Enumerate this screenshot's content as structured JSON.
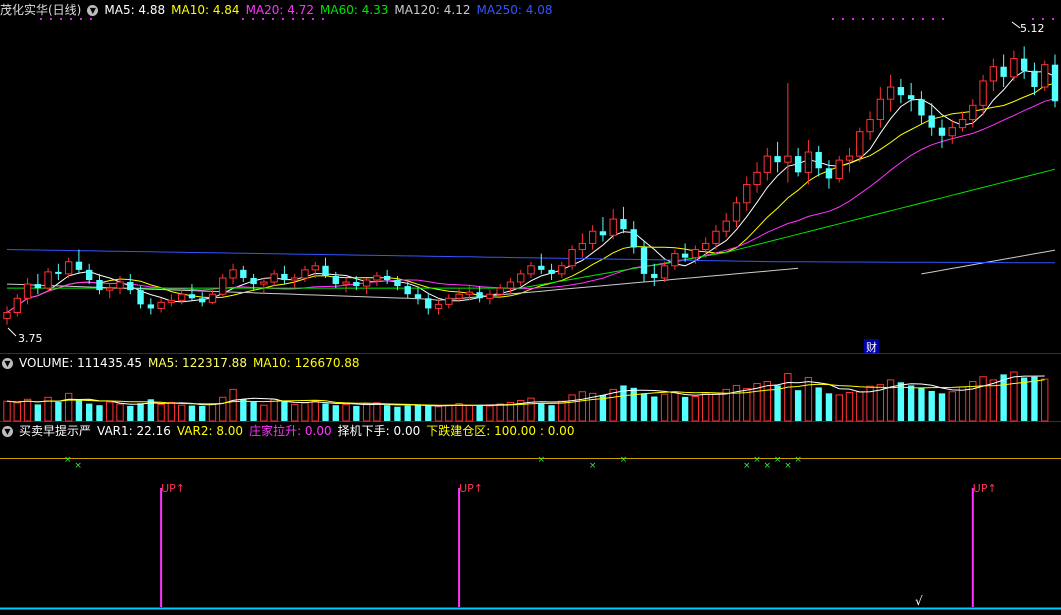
{
  "price_header": {
    "stock": "茂化实华(日线)",
    "ma": [
      {
        "label": "MA5: 4.88",
        "color": "#ffffff"
      },
      {
        "label": "MA10: 4.84",
        "color": "#ffff00"
      },
      {
        "label": "MA20: 4.72",
        "color": "#ff33ff"
      },
      {
        "label": "MA60: 4.33",
        "color": "#00e600"
      },
      {
        "label": "MA120: 4.12",
        "color": "#cccccc"
      },
      {
        "label": "MA250: 4.08",
        "color": "#3355ff"
      }
    ]
  },
  "volume_header": {
    "items": [
      {
        "label": "VOLUME: 111435.45",
        "color": "#ffffff"
      },
      {
        "label": "MA5: 122317.88",
        "color": "#ffff66"
      },
      {
        "label": "MA10: 126670.88",
        "color": "#ffff00"
      }
    ]
  },
  "indicator_header": {
    "items": [
      {
        "label": "买卖早提示严",
        "color": "#ffffff"
      },
      {
        "label": "VAR1: 22.16",
        "color": "#ffffff"
      },
      {
        "label": "VAR2: 8.00",
        "color": "#ffff00"
      },
      {
        "label": "庄家拉升: 0.00",
        "color": "#ff33ff"
      },
      {
        "label": "择机下手: 0.00",
        "color": "#ffffff"
      },
      {
        "label": "下跌建仓区: 100.00 : 0.00",
        "color": "#ffff00"
      }
    ]
  },
  "annotations": {
    "high_label": "5.12",
    "low_label": "3.75",
    "cai_label": "财",
    "up_label": "UP↑",
    "check_label": "√"
  },
  "chart_data": {
    "type": "candlestick",
    "price_range": [
      3.65,
      5.25
    ],
    "candles": [
      {
        "o": 3.78,
        "h": 3.84,
        "l": 3.75,
        "c": 3.81
      },
      {
        "o": 3.81,
        "h": 3.9,
        "l": 3.79,
        "c": 3.88
      },
      {
        "o": 3.88,
        "h": 3.98,
        "l": 3.85,
        "c": 3.95
      },
      {
        "o": 3.95,
        "h": 4.0,
        "l": 3.9,
        "c": 3.93
      },
      {
        "o": 3.93,
        "h": 4.03,
        "l": 3.91,
        "c": 4.01
      },
      {
        "o": 4.01,
        "h": 4.05,
        "l": 3.97,
        "c": 4.0
      },
      {
        "o": 4.0,
        "h": 4.08,
        "l": 3.98,
        "c": 4.06
      },
      {
        "o": 4.06,
        "h": 4.12,
        "l": 4.0,
        "c": 4.02
      },
      {
        "o": 4.02,
        "h": 4.05,
        "l": 3.95,
        "c": 3.97
      },
      {
        "o": 3.97,
        "h": 4.0,
        "l": 3.9,
        "c": 3.92
      },
      {
        "o": 3.92,
        "h": 3.95,
        "l": 3.88,
        "c": 3.93
      },
      {
        "o": 3.93,
        "h": 3.99,
        "l": 3.9,
        "c": 3.96
      },
      {
        "o": 3.96,
        "h": 4.0,
        "l": 3.9,
        "c": 3.92
      },
      {
        "o": 3.92,
        "h": 3.94,
        "l": 3.83,
        "c": 3.85
      },
      {
        "o": 3.85,
        "h": 3.88,
        "l": 3.8,
        "c": 3.83
      },
      {
        "o": 3.83,
        "h": 3.88,
        "l": 3.81,
        "c": 3.86
      },
      {
        "o": 3.86,
        "h": 3.9,
        "l": 3.84,
        "c": 3.87
      },
      {
        "o": 3.87,
        "h": 3.92,
        "l": 3.85,
        "c": 3.9
      },
      {
        "o": 3.9,
        "h": 3.95,
        "l": 3.87,
        "c": 3.88
      },
      {
        "o": 3.88,
        "h": 3.91,
        "l": 3.84,
        "c": 3.86
      },
      {
        "o": 3.86,
        "h": 3.92,
        "l": 3.85,
        "c": 3.9
      },
      {
        "o": 3.9,
        "h": 4.0,
        "l": 3.89,
        "c": 3.98
      },
      {
        "o": 3.98,
        "h": 4.05,
        "l": 3.95,
        "c": 4.02
      },
      {
        "o": 4.02,
        "h": 4.04,
        "l": 3.96,
        "c": 3.98
      },
      {
        "o": 3.98,
        "h": 4.0,
        "l": 3.92,
        "c": 3.95
      },
      {
        "o": 3.95,
        "h": 3.98,
        "l": 3.9,
        "c": 3.96
      },
      {
        "o": 3.96,
        "h": 4.02,
        "l": 3.94,
        "c": 4.0
      },
      {
        "o": 4.0,
        "h": 4.04,
        "l": 3.95,
        "c": 3.97
      },
      {
        "o": 3.97,
        "h": 4.0,
        "l": 3.93,
        "c": 3.98
      },
      {
        "o": 3.98,
        "h": 4.04,
        "l": 3.96,
        "c": 4.02
      },
      {
        "o": 4.02,
        "h": 4.06,
        "l": 3.98,
        "c": 4.04
      },
      {
        "o": 4.04,
        "h": 4.08,
        "l": 3.98,
        "c": 3.99
      },
      {
        "o": 3.99,
        "h": 4.01,
        "l": 3.93,
        "c": 3.95
      },
      {
        "o": 3.95,
        "h": 3.98,
        "l": 3.91,
        "c": 3.96
      },
      {
        "o": 3.96,
        "h": 3.99,
        "l": 3.92,
        "c": 3.94
      },
      {
        "o": 3.94,
        "h": 3.98,
        "l": 3.9,
        "c": 3.97
      },
      {
        "o": 3.97,
        "h": 4.01,
        "l": 3.94,
        "c": 3.99
      },
      {
        "o": 3.99,
        "h": 4.02,
        "l": 3.95,
        "c": 3.97
      },
      {
        "o": 3.97,
        "h": 3.99,
        "l": 3.92,
        "c": 3.94
      },
      {
        "o": 3.94,
        "h": 3.96,
        "l": 3.88,
        "c": 3.9
      },
      {
        "o": 3.9,
        "h": 3.93,
        "l": 3.85,
        "c": 3.88
      },
      {
        "o": 3.88,
        "h": 3.9,
        "l": 3.8,
        "c": 3.83
      },
      {
        "o": 3.83,
        "h": 3.87,
        "l": 3.8,
        "c": 3.85
      },
      {
        "o": 3.85,
        "h": 3.9,
        "l": 3.83,
        "c": 3.88
      },
      {
        "o": 3.88,
        "h": 3.93,
        "l": 3.86,
        "c": 3.9
      },
      {
        "o": 3.9,
        "h": 3.94,
        "l": 3.87,
        "c": 3.91
      },
      {
        "o": 3.91,
        "h": 3.94,
        "l": 3.86,
        "c": 3.88
      },
      {
        "o": 3.88,
        "h": 3.92,
        "l": 3.85,
        "c": 3.9
      },
      {
        "o": 3.9,
        "h": 3.95,
        "l": 3.88,
        "c": 3.93
      },
      {
        "o": 3.93,
        "h": 3.98,
        "l": 3.9,
        "c": 3.96
      },
      {
        "o": 3.96,
        "h": 4.02,
        "l": 3.94,
        "c": 4.0
      },
      {
        "o": 4.0,
        "h": 4.06,
        "l": 3.98,
        "c": 4.04
      },
      {
        "o": 4.04,
        "h": 4.1,
        "l": 4.0,
        "c": 4.02
      },
      {
        "o": 4.02,
        "h": 4.05,
        "l": 3.97,
        "c": 4.0
      },
      {
        "o": 4.0,
        "h": 4.06,
        "l": 3.98,
        "c": 4.04
      },
      {
        "o": 4.04,
        "h": 4.14,
        "l": 4.02,
        "c": 4.12
      },
      {
        "o": 4.12,
        "h": 4.2,
        "l": 4.08,
        "c": 4.15
      },
      {
        "o": 4.15,
        "h": 4.24,
        "l": 4.12,
        "c": 4.21
      },
      {
        "o": 4.21,
        "h": 4.28,
        "l": 4.16,
        "c": 4.19
      },
      {
        "o": 4.19,
        "h": 4.32,
        "l": 4.17,
        "c": 4.27
      },
      {
        "o": 4.27,
        "h": 4.33,
        "l": 4.2,
        "c": 4.22
      },
      {
        "o": 4.22,
        "h": 4.26,
        "l": 4.1,
        "c": 4.13
      },
      {
        "o": 4.13,
        "h": 4.16,
        "l": 3.96,
        "c": 4.0
      },
      {
        "o": 4.0,
        "h": 4.05,
        "l": 3.94,
        "c": 3.98
      },
      {
        "o": 3.98,
        "h": 4.06,
        "l": 3.96,
        "c": 4.04
      },
      {
        "o": 4.04,
        "h": 4.12,
        "l": 4.02,
        "c": 4.1
      },
      {
        "o": 4.1,
        "h": 4.15,
        "l": 4.06,
        "c": 4.08
      },
      {
        "o": 4.08,
        "h": 4.14,
        "l": 4.05,
        "c": 4.12
      },
      {
        "o": 4.12,
        "h": 4.18,
        "l": 4.08,
        "c": 4.15
      },
      {
        "o": 4.15,
        "h": 4.24,
        "l": 4.12,
        "c": 4.21
      },
      {
        "o": 4.21,
        "h": 4.3,
        "l": 4.18,
        "c": 4.26
      },
      {
        "o": 4.26,
        "h": 4.38,
        "l": 4.23,
        "c": 4.35
      },
      {
        "o": 4.35,
        "h": 4.48,
        "l": 4.31,
        "c": 4.44
      },
      {
        "o": 4.44,
        "h": 4.55,
        "l": 4.4,
        "c": 4.5
      },
      {
        "o": 4.5,
        "h": 4.62,
        "l": 4.46,
        "c": 4.58
      },
      {
        "o": 4.58,
        "h": 4.65,
        "l": 4.5,
        "c": 4.55
      },
      {
        "o": 4.55,
        "h": 4.94,
        "l": 4.45,
        "c": 4.58
      },
      {
        "o": 4.58,
        "h": 4.62,
        "l": 4.48,
        "c": 4.5
      },
      {
        "o": 4.5,
        "h": 4.66,
        "l": 4.44,
        "c": 4.6
      },
      {
        "o": 4.6,
        "h": 4.63,
        "l": 4.48,
        "c": 4.52
      },
      {
        "o": 4.52,
        "h": 4.56,
        "l": 4.42,
        "c": 4.47
      },
      {
        "o": 4.47,
        "h": 4.58,
        "l": 4.45,
        "c": 4.56
      },
      {
        "o": 4.56,
        "h": 4.62,
        "l": 4.5,
        "c": 4.58
      },
      {
        "o": 4.58,
        "h": 4.72,
        "l": 4.55,
        "c": 4.7
      },
      {
        "o": 4.7,
        "h": 4.8,
        "l": 4.66,
        "c": 4.76
      },
      {
        "o": 4.76,
        "h": 4.92,
        "l": 4.72,
        "c": 4.86
      },
      {
        "o": 4.86,
        "h": 4.98,
        "l": 4.8,
        "c": 4.92
      },
      {
        "o": 4.92,
        "h": 4.96,
        "l": 4.84,
        "c": 4.88
      },
      {
        "o": 4.88,
        "h": 4.94,
        "l": 4.8,
        "c": 4.86
      },
      {
        "o": 4.86,
        "h": 4.9,
        "l": 4.74,
        "c": 4.78
      },
      {
        "o": 4.78,
        "h": 4.84,
        "l": 4.68,
        "c": 4.72
      },
      {
        "o": 4.72,
        "h": 4.76,
        "l": 4.62,
        "c": 4.68
      },
      {
        "o": 4.68,
        "h": 4.76,
        "l": 4.64,
        "c": 4.72
      },
      {
        "o": 4.72,
        "h": 4.8,
        "l": 4.7,
        "c": 4.76
      },
      {
        "o": 4.76,
        "h": 4.86,
        "l": 4.72,
        "c": 4.83
      },
      {
        "o": 4.83,
        "h": 4.98,
        "l": 4.78,
        "c": 4.95
      },
      {
        "o": 4.95,
        "h": 5.06,
        "l": 4.9,
        "c": 5.02
      },
      {
        "o": 5.02,
        "h": 5.08,
        "l": 4.92,
        "c": 4.97
      },
      {
        "o": 4.97,
        "h": 5.1,
        "l": 4.95,
        "c": 5.06
      },
      {
        "o": 5.06,
        "h": 5.12,
        "l": 4.96,
        "c": 5.0
      },
      {
        "o": 5.0,
        "h": 5.04,
        "l": 4.88,
        "c": 4.92
      },
      {
        "o": 4.92,
        "h": 5.05,
        "l": 4.9,
        "c": 5.03
      },
      {
        "o": 5.03,
        "h": 5.08,
        "l": 4.82,
        "c": 4.85
      }
    ],
    "volume": [
      50,
      46,
      55,
      42,
      60,
      48,
      70,
      52,
      44,
      40,
      48,
      43,
      38,
      45,
      55,
      42,
      47,
      40,
      39,
      38,
      44,
      60,
      80,
      55,
      48,
      40,
      55,
      50,
      42,
      46,
      51,
      44,
      40,
      42,
      38,
      44,
      46,
      40,
      36,
      39,
      42,
      38,
      36,
      40,
      44,
      39,
      41,
      38,
      43,
      47,
      52,
      58,
      44,
      40,
      50,
      66,
      74,
      70,
      66,
      80,
      90,
      84,
      70,
      62,
      68,
      74,
      61,
      62,
      71,
      68,
      80,
      90,
      82,
      95,
      100,
      90,
      120,
      78,
      110,
      85,
      70,
      66,
      72,
      74,
      88,
      92,
      104,
      98,
      90,
      84,
      76,
      70,
      74,
      86,
      100,
      112,
      104,
      118,
      124,
      110,
      112,
      106
    ],
    "lines": {
      "MA5": {
        "color": "#ffffff"
      },
      "MA10": {
        "color": "#ffff00"
      },
      "MA20": {
        "color": "#ff33ff"
      },
      "MA60": {
        "color": "#00e600"
      },
      "MA120": {
        "color": "#cccccc"
      },
      "MA250": {
        "color": "#3355ff"
      }
    },
    "up_signal_indices": [
      15,
      44,
      94
    ],
    "x_marker_indices": [
      3,
      4,
      52,
      57,
      60,
      72,
      73,
      74,
      75,
      76,
      77
    ]
  }
}
